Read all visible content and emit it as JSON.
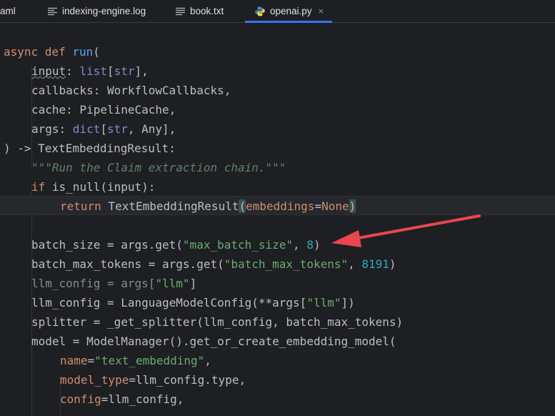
{
  "tabs": [
    {
      "label": "aml",
      "icon": "yaml-file-icon",
      "active": false
    },
    {
      "label": "indexing-engine.log",
      "icon": "log-file-icon",
      "active": false
    },
    {
      "label": "book.txt",
      "icon": "text-file-icon",
      "active": false
    },
    {
      "label": "openai.py",
      "icon": "python-file-icon",
      "active": true,
      "close": "×"
    }
  ],
  "code": {
    "l1": {
      "a": "async ",
      "b": "def ",
      "c": "run",
      "d": "("
    },
    "l2": {
      "a": "input",
      "b": ": ",
      "c": "list",
      "d": "[",
      "e": "str",
      "f": "],"
    },
    "l3": {
      "a": "callbacks: WorkflowCallbacks,"
    },
    "l4": {
      "a": "cache: PipelineCache,"
    },
    "l5": {
      "a": "args: ",
      "b": "dict",
      "c": "[",
      "d": "str",
      "e": ", Any],"
    },
    "l6": {
      "a": ") -> TextEmbeddingResult:"
    },
    "l7": {
      "a": "\"\"\"Run the Claim extraction chain.\"\"\""
    },
    "l8": {
      "a": "if ",
      "b": "is_null(input):"
    },
    "l9": {
      "a": "return ",
      "b": "TextEmbeddingResult",
      "c": "(",
      "d": "embeddings",
      "e": "=",
      "f": "None",
      "g": ")"
    },
    "l10": {
      "a": "batch_size = args.get(",
      "b": "\"max_batch_size\"",
      "c": ", ",
      "d": "8",
      "e": ")"
    },
    "l11": {
      "a": "batch_max_tokens = args.get(",
      "b": "\"batch_max_tokens\"",
      "c": ", ",
      "d": "8191",
      "e": ")"
    },
    "l12": {
      "a": "llm_config = args[",
      "b": "\"llm\"",
      "c": "]"
    },
    "l13": {
      "a": "llm_config = LanguageModelConfig(**args[",
      "b": "\"llm\"",
      "c": "])"
    },
    "l14": {
      "a": "splitter = _get_splitter(llm_config, batch_max_tokens)"
    },
    "l15": {
      "a": "model = ModelManager().get_or_create_embedding_model("
    },
    "l16": {
      "a": "name",
      "b": "=",
      "c": "\"text_embedding\"",
      "d": ","
    },
    "l17": {
      "a": "model_type",
      "b": "=llm_config.type,"
    },
    "l18": {
      "a": "config",
      "b": "=llm_config,"
    }
  },
  "annotation": {
    "color": "#e8474d"
  }
}
